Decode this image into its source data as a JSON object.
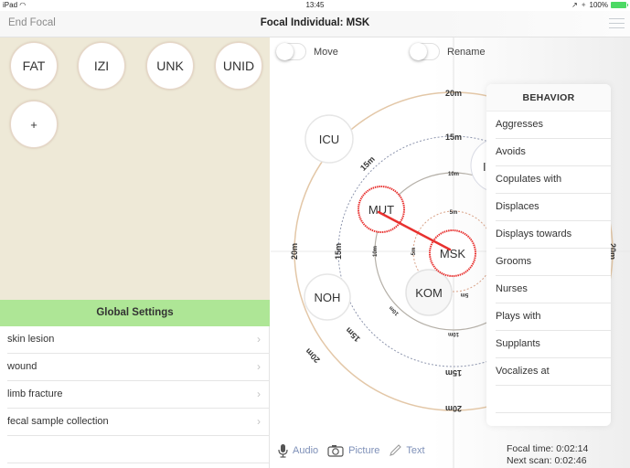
{
  "status_bar": {
    "device": "iPad",
    "wifi_icon": "wifi-icon",
    "time": "13:45",
    "location_icon": "location-arrow-icon",
    "bluetooth_icon": "bluetooth-icon",
    "battery": "100%",
    "battery_color": "#4cd964"
  },
  "nav": {
    "left_button": "End Focal",
    "title": "Focal Individual: MSK",
    "menu_icon": "hamburger-menu-icon"
  },
  "individuals": {
    "background": "#eee9d7",
    "buttons": [
      "FAT",
      "IZI",
      "UNK",
      "UNID"
    ],
    "add_label": "+"
  },
  "global_settings": {
    "title": "Global Settings",
    "header_color": "#aee696",
    "items": [
      {
        "label": "skin lesion"
      },
      {
        "label": "wound"
      },
      {
        "label": "limb fracture"
      },
      {
        "label": "fecal sample collection"
      }
    ]
  },
  "map": {
    "toggles": [
      {
        "label": "Move",
        "on": false
      },
      {
        "label": "Rename",
        "on": false
      }
    ],
    "rings": [
      {
        "label": "5m",
        "color": "#d9a48a"
      },
      {
        "label": "10m",
        "color": "#b5b0a8"
      },
      {
        "label": "15m",
        "color": "#8e96ae"
      },
      {
        "label": "20m",
        "color": "#e3c7a7"
      }
    ],
    "focal": "MSK",
    "nodes": [
      "ICU",
      "IT",
      "MUT",
      "NOH",
      "KOM",
      "MSK"
    ],
    "selected_nodes": [
      "MUT",
      "MSK"
    ],
    "interaction_line_color": "#e8312f"
  },
  "behavior": {
    "title": "BEHAVIOR",
    "items": [
      "Aggresses",
      "Avoids",
      "Copulates with",
      "Displaces",
      "Displays towards",
      "Grooms",
      "Nurses",
      "Plays with",
      "Supplants",
      "Vocalizes at"
    ]
  },
  "tools": {
    "audio": "Audio",
    "picture": "Picture",
    "text": "Text",
    "color": "#7e90b8"
  },
  "timers": {
    "focal_time": "Focal time: 0:02:14",
    "next_scan": "Next scan: 0:02:46"
  }
}
